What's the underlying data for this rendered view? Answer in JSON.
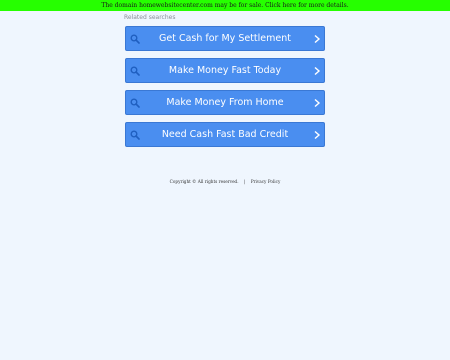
{
  "banner": {
    "text": "The domain homewebsitecenter.com may be for sale. Click here for more details."
  },
  "related": {
    "label": "Related searches",
    "items": [
      {
        "label": "Get Cash for My Settlement"
      },
      {
        "label": "Make Money Fast Today"
      },
      {
        "label": "Make Money From Home"
      },
      {
        "label": "Need Cash Fast Bad Credit"
      }
    ]
  },
  "footer": {
    "copyright": "Copyright © All rights reserved.",
    "separator": "|",
    "privacy": "Privacy Policy"
  },
  "colors": {
    "banner_bg": "#26ff00",
    "page_bg": "#eff6fe",
    "button_bg": "#4a8ef0",
    "icon_color": "#1f5fc0"
  },
  "icons": {
    "search": "search-icon",
    "chevron": "chevron-right-icon"
  }
}
